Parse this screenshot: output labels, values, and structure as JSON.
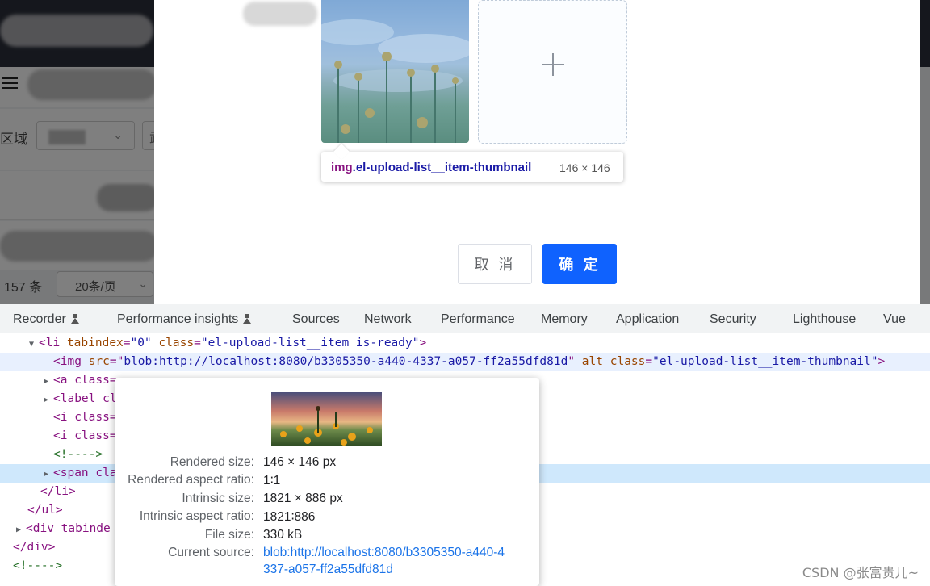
{
  "background_app": {
    "region_label": "区域",
    "region_select2_value": "武",
    "pagination": {
      "total": "157 条",
      "page_size": "20条/页"
    }
  },
  "dialog": {
    "element_tooltip": {
      "tag": "img",
      "class_name": ".el-upload-list__item-thumbnail",
      "size": "146 × 146"
    },
    "cancel_label": "取 消",
    "confirm_label": "确 定",
    "colors": {
      "primary": "#0f62fe"
    }
  },
  "devtools": {
    "tabs": [
      "Recorder",
      "Performance insights",
      "Sources",
      "Network",
      "Performance",
      "Memory",
      "Application",
      "Security",
      "Lighthouse",
      "Vue"
    ],
    "elements": {
      "li_open": {
        "tag": "li",
        "a1_name": "tabindex",
        "a1_value": "\"0\"",
        "a2_name": "class",
        "a2_value": "\"el-upload-list__item is-ready\""
      },
      "img": {
        "tag": "img",
        "src_name": "src",
        "src_value": "blob:http://localhost:8080/b3305350-a440-4337-a057-ff2a55dfd81d",
        "alt_name": "alt",
        "class_name": "class",
        "class_value": "\"el-upload-list__item-thumbnail\""
      },
      "a_line": "<a class=",
      "label_line": "<label cl",
      "i_line": "<i class=",
      "comment": "<!---->",
      "span_line": "<span cla",
      "li_close": "</li>",
      "ul_close": "</ul>",
      "div_line": "<div tabinde",
      "div_close": "</div>",
      "comment2": "<!---->"
    },
    "image_popup": {
      "rows": [
        {
          "label": "Rendered size:",
          "value": "146 × 146 px"
        },
        {
          "label": "Rendered aspect ratio:",
          "value": "1∶1"
        },
        {
          "label": "Intrinsic size:",
          "value": "1821 × 886 px"
        },
        {
          "label": "Intrinsic aspect ratio:",
          "value": "1821∶886"
        },
        {
          "label": "File size:",
          "value": "330 kB"
        },
        {
          "label": "Current source:",
          "value_line1": "blob:http://localhost:8080/b3305350-a440-4",
          "value_line2": "337-a057-ff2a55dfd81d"
        }
      ]
    }
  },
  "watermark": "CSDN @张富贵儿~"
}
